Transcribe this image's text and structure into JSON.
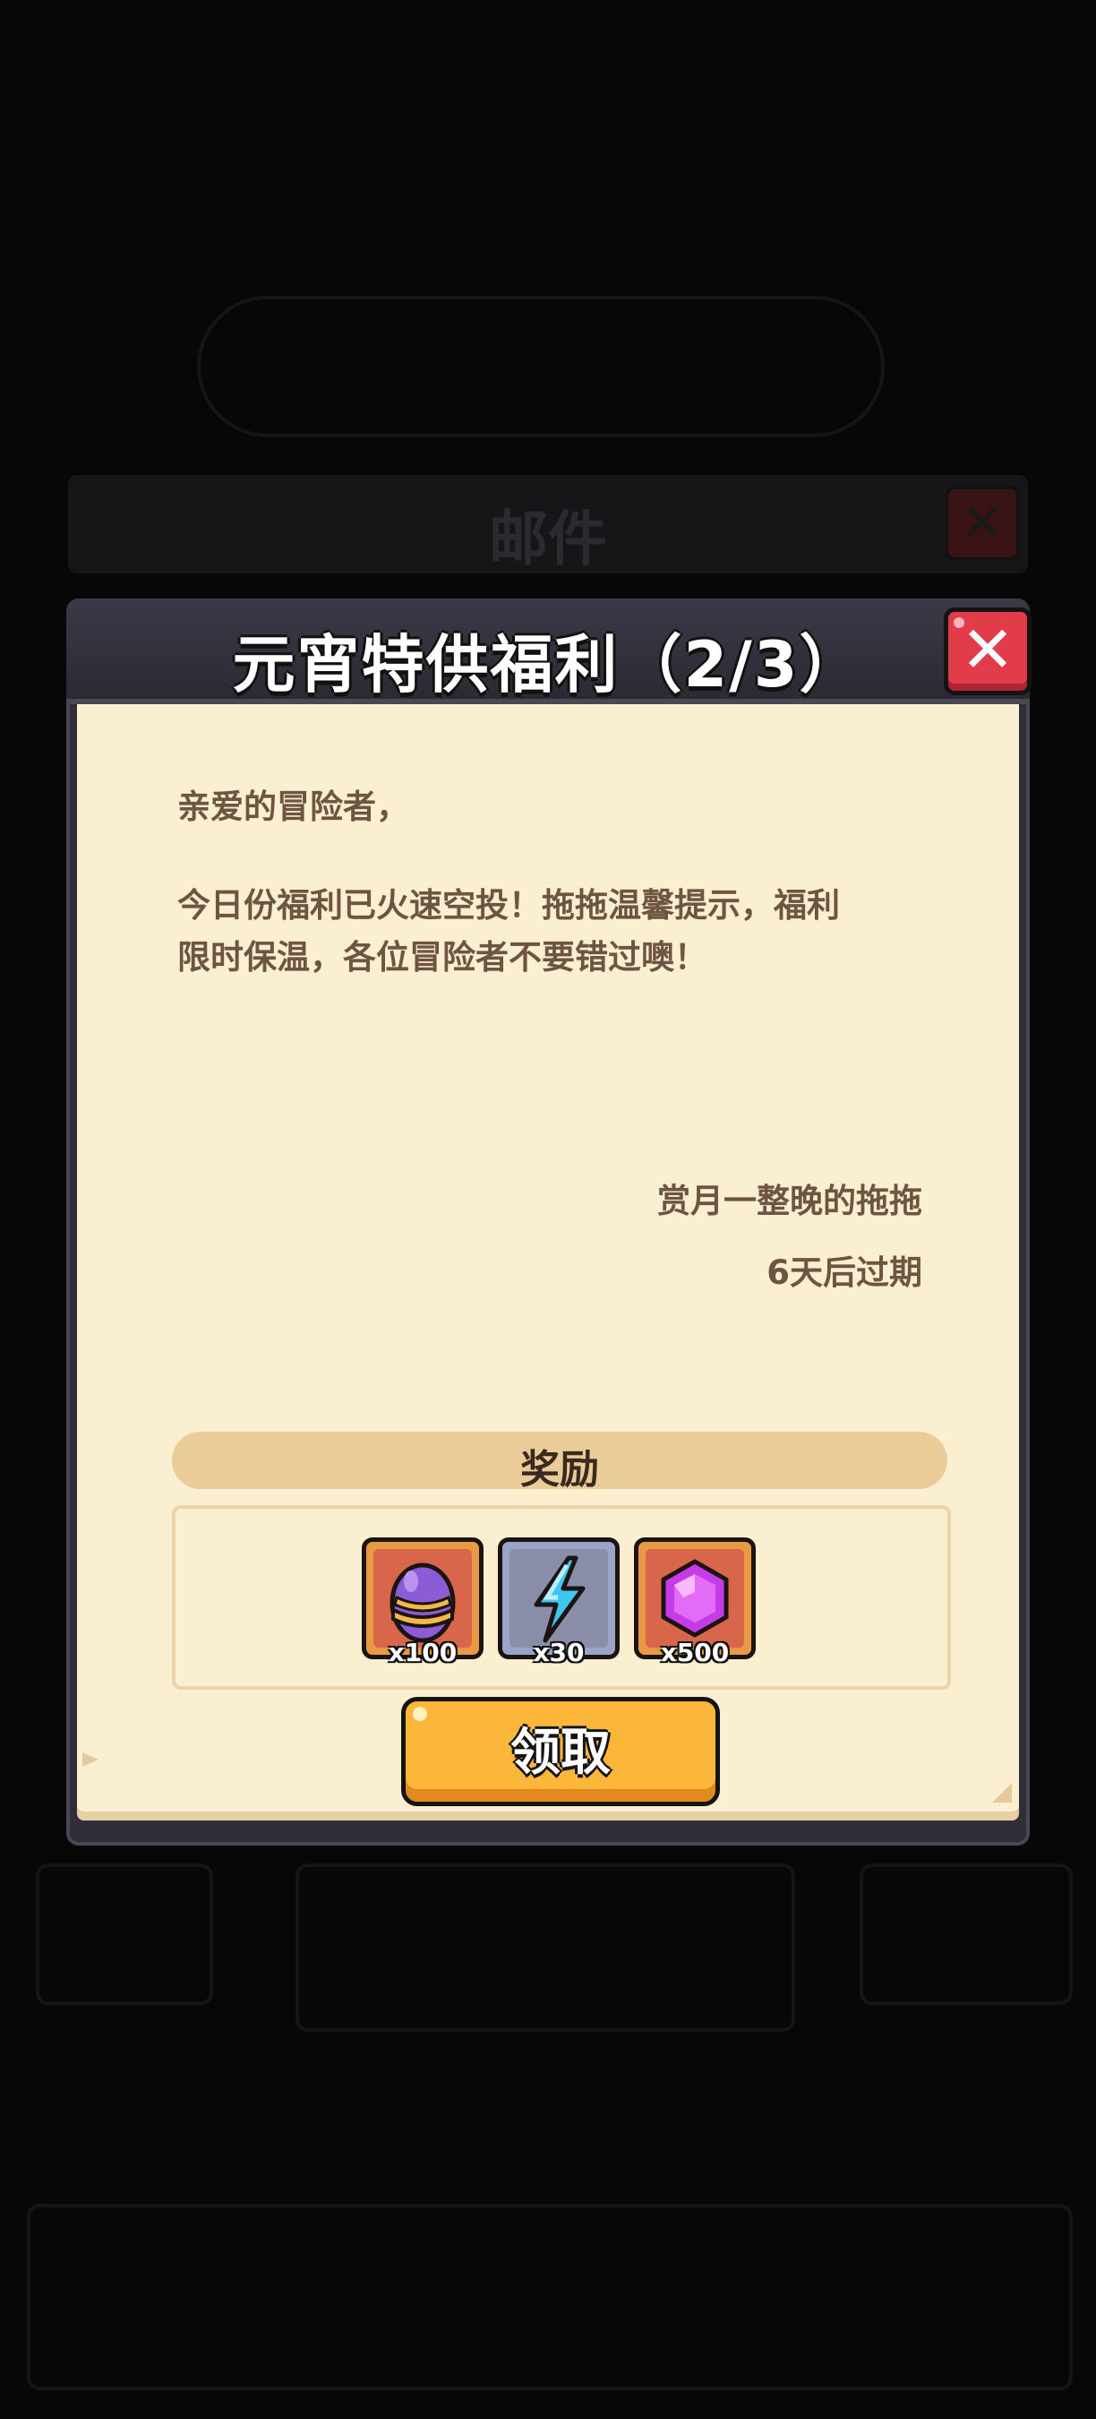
{
  "background": {
    "mail_title": "邮件",
    "mail_close_icon": "close-icon"
  },
  "dialog": {
    "title": "元宵特供福利（2/3）",
    "close_icon": "close-icon",
    "greeting": "亲爱的冒险者，",
    "body_line1": "今日份福利已火速空投！拖拖温馨提示，福利",
    "body_line2": "限时保温，各位冒险者不要错过噢！",
    "signature": "赏月一整晚的拖拖",
    "expiry": "6天后过期",
    "rewards_label": "奖励",
    "rewards": [
      {
        "icon": "purple-egg-icon",
        "count": "x100"
      },
      {
        "icon": "lightning-bolt-icon",
        "count": "x30"
      },
      {
        "icon": "purple-gem-icon",
        "count": "x500"
      }
    ],
    "claim_label": "领取"
  },
  "colors": {
    "accent": "#fcb63a",
    "paper": "#fbefd1",
    "close": "#e23b4a",
    "text": "#6e5543"
  }
}
